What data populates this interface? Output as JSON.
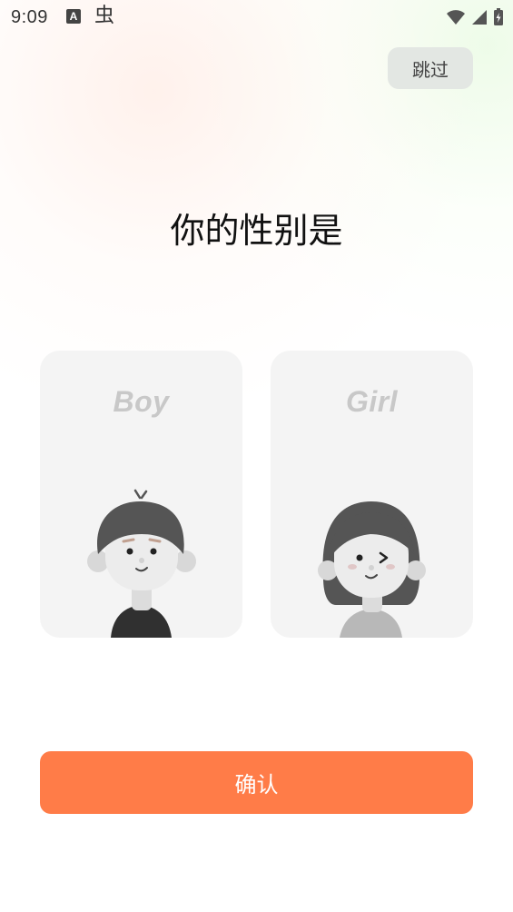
{
  "status_bar": {
    "time": "9:09",
    "icons": {
      "app_icon_a": "A",
      "app_icon_bug": "虫",
      "wifi": "wifi-icon",
      "signal": "signal-icon",
      "battery": "battery-charging-icon"
    }
  },
  "header": {
    "skip_label": "跳过"
  },
  "main": {
    "title": "你的性别是",
    "options": [
      {
        "label": "Boy"
      },
      {
        "label": "Girl"
      }
    ],
    "confirm_label": "确认"
  },
  "colors": {
    "accent": "#ff7c48",
    "card_bg": "#f4f4f4",
    "skip_bg": "#e3e7e3",
    "label_gray": "#c8c8c8"
  }
}
